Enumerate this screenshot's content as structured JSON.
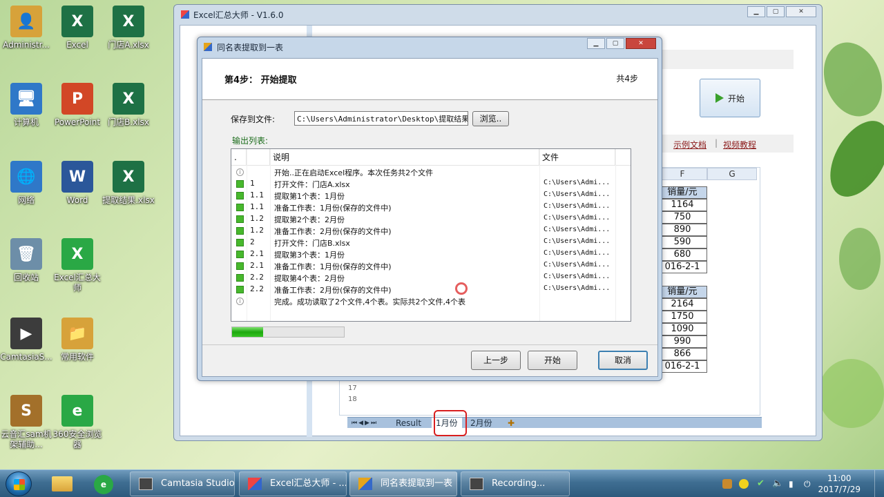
{
  "desktop_icons": [
    {
      "label": "Administr...",
      "color": "#d7a23a",
      "glyph": "👤"
    },
    {
      "label": "Excel",
      "color": "#1e7145",
      "glyph": "X"
    },
    {
      "label": "门店A.xlsx",
      "color": "#1e7145",
      "glyph": "X"
    },
    {
      "label": "计算机",
      "color": "#2f78c8",
      "glyph": "🖥"
    },
    {
      "label": "PowerPoint",
      "color": "#d24726",
      "glyph": "P"
    },
    {
      "label": "门店B.xlsx",
      "color": "#1e7145",
      "glyph": "X"
    },
    {
      "label": "网络",
      "color": "#2f78c8",
      "glyph": "🌐"
    },
    {
      "label": "Word",
      "color": "#2b579a",
      "glyph": "W"
    },
    {
      "label": "提取结果.xlsx",
      "color": "#1e7145",
      "glyph": "X"
    },
    {
      "label": "回收站",
      "color": "#6d8ea8",
      "glyph": "🗑"
    },
    {
      "label": "Excel汇总大师",
      "color": "#2aa845",
      "glyph": "X"
    },
    {
      "label": "CamtasiaS...",
      "color": "#3c3c3c",
      "glyph": "▶"
    },
    {
      "label": "常用软件",
      "color": "#d7a23a",
      "glyph": "📁"
    },
    {
      "label": "云音汇sam机架辅助...",
      "color": "#a3702a",
      "glyph": "S"
    },
    {
      "label": "360安全浏览器",
      "color": "#2aa845",
      "glyph": "e"
    }
  ],
  "main_window": {
    "title": "Excel汇总大师 - V1.6.0",
    "start_label": "开始",
    "links": [
      "示例文档",
      "视频教程"
    ],
    "link_separator": "|",
    "columns": [
      "F",
      "G"
    ],
    "table1": {
      "header": "销量/元",
      "values": [
        "1164",
        "750",
        "890",
        "590",
        "680"
      ],
      "date": "016-2-1"
    },
    "table2": {
      "header": "销量/元",
      "values": [
        "2164",
        "1750",
        "1090",
        "990",
        "866"
      ],
      "date": "016-2-1"
    },
    "row_numbers": [
      "17",
      "18"
    ],
    "sheet_tabs": [
      "Result",
      "1月份",
      "2月份"
    ],
    "nav_glyphs": [
      "⏮",
      "◀",
      "▶",
      "⏭"
    ]
  },
  "dialog": {
    "title": "同名表提取到一表",
    "step_title": "第4步： 开始提取",
    "step_total": "共4步",
    "save_label": "保存到文件:",
    "save_path": "C:\\Users\\Administrator\\Desktop\\提取结果.xlsx",
    "browse_label": "浏览..",
    "output_label": "输出列表:",
    "columns": [
      ".",
      "说明",
      "文件"
    ],
    "rows": [
      {
        "icon": "info",
        "no": "",
        "desc": "开始..正在启动Excel程序。本次任务共2个文件",
        "file": ""
      },
      {
        "icon": "ok",
        "no": "1",
        "desc": "打开文件：门店A.xlsx",
        "file": "C:\\Users\\Admi..."
      },
      {
        "icon": "ok",
        "no": "1.1",
        "desc": "提取第1个表：1月份",
        "file": "C:\\Users\\Admi..."
      },
      {
        "icon": "ok",
        "no": "1.1",
        "desc": "准备工作表：1月份(保存的文件中)",
        "file": "C:\\Users\\Admi..."
      },
      {
        "icon": "ok",
        "no": "1.2",
        "desc": "提取第2个表：2月份",
        "file": "C:\\Users\\Admi..."
      },
      {
        "icon": "ok",
        "no": "1.2",
        "desc": "准备工作表：2月份(保存的文件中)",
        "file": "C:\\Users\\Admi..."
      },
      {
        "icon": "ok",
        "no": "2",
        "desc": "打开文件：门店B.xlsx",
        "file": "C:\\Users\\Admi..."
      },
      {
        "icon": "ok",
        "no": "2.1",
        "desc": "提取第3个表：1月份",
        "file": "C:\\Users\\Admi..."
      },
      {
        "icon": "ok",
        "no": "2.1",
        "desc": "准备工作表：1月份(保存的文件中)",
        "file": "C:\\Users\\Admi..."
      },
      {
        "icon": "ok",
        "no": "2.2",
        "desc": "提取第4个表：2月份",
        "file": "C:\\Users\\Admi..."
      },
      {
        "icon": "ok",
        "no": "2.2",
        "desc": "准备工作表：2月份(保存的文件中)",
        "file": "C:\\Users\\Admi..."
      },
      {
        "icon": "info",
        "no": "",
        "desc": "完成。成功读取了2个文件,4个表。实际共2个文件,4个表",
        "file": ""
      }
    ],
    "progress_fraction": 0.28,
    "buttons": {
      "prev": "上一步",
      "start": "开始",
      "cancel": "取消"
    }
  },
  "taskbar": {
    "tasks": [
      "Camtasia Studio...",
      "Excel汇总大师 - ...",
      "同名表提取到一表",
      "Recording..."
    ],
    "time": "11:00",
    "date": "2017/7/29"
  },
  "colors": {
    "accent": "#3c7fb1",
    "progress": "#1ea80f",
    "highlight": "#d81e1e"
  }
}
